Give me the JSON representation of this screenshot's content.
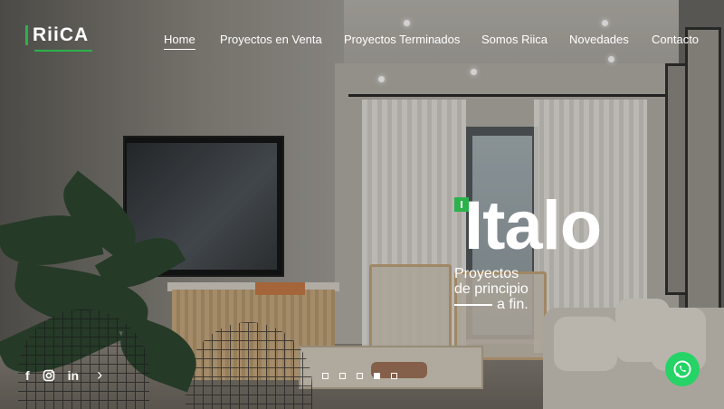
{
  "brand": {
    "logo_text": "RiiCA",
    "accent_color": "#2bb24c"
  },
  "nav": {
    "items": [
      {
        "label": "Home",
        "active": true
      },
      {
        "label": "Proyectos en Venta",
        "active": false
      },
      {
        "label": "Proyectos Terminados",
        "active": false
      },
      {
        "label": "Somos Riica",
        "active": false
      },
      {
        "label": "Novedades",
        "active": false
      },
      {
        "label": "Contacto",
        "active": false
      }
    ]
  },
  "hero": {
    "title": "Italo",
    "tagline_line1": "Proyectos",
    "tagline_line2": "de principio",
    "tagline_line3": "a fin."
  },
  "social": {
    "facebook_icon": "f",
    "instagram_icon": "instagram-icon",
    "linkedin_icon": "in",
    "next_icon": "›"
  },
  "slider": {
    "total_slides": 5,
    "active_index": 4
  },
  "whatsapp": {
    "icon": "whatsapp-icon",
    "color": "#25d366"
  }
}
